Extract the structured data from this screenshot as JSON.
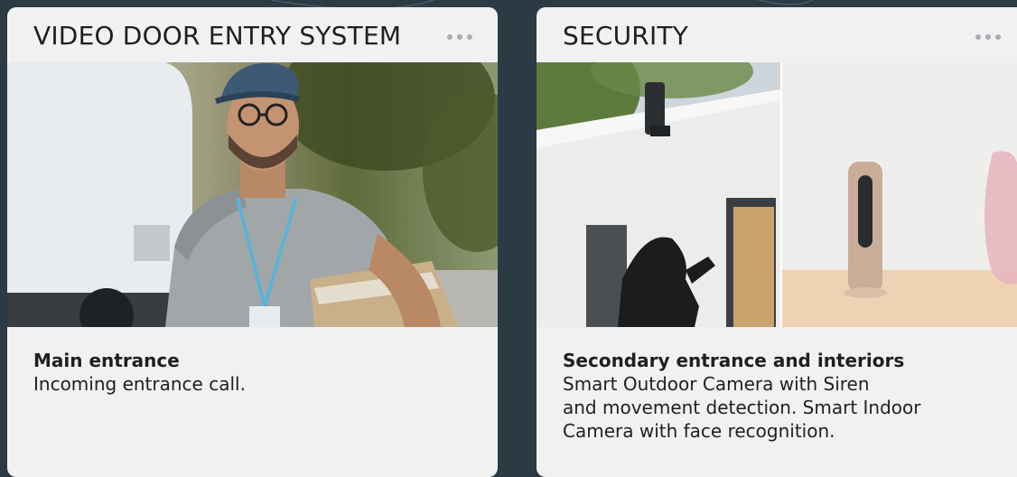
{
  "cards": [
    {
      "title": "VIDEO DOOR ENTRY SYSTEM",
      "image_icon": "delivery-person-photo",
      "subtitle": "Main entrance",
      "description": [
        "Incoming entrance call."
      ]
    },
    {
      "title": "SECURITY",
      "image_icon": "security-cameras-photo",
      "subtitle": "Secondary entrance and interiors",
      "description": [
        "Smart Outdoor Camera with Siren",
        "and movement detection. Smart Indoor",
        "Camera with face recognition."
      ]
    }
  ],
  "more_icon": "more-horizontal-icon",
  "colors": {
    "background": "#2c3a44",
    "card": "#f1f1f1",
    "text": "#1d1f21",
    "dots": "#a8aeb3"
  }
}
